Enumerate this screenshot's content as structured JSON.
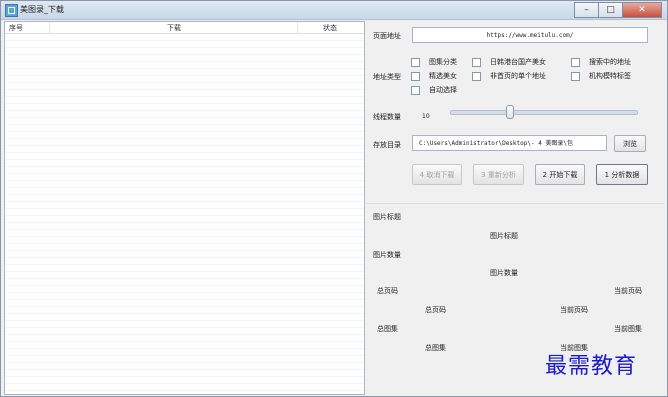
{
  "window": {
    "title": "美图录_下载",
    "minimize": "–",
    "maximize": "□",
    "close": "✕"
  },
  "list": {
    "columns": [
      "序号",
      "下载",
      "状态"
    ]
  },
  "form": {
    "page_url_label": "页面地址",
    "page_url_value": "https://www.meitulu.com/",
    "addr_type_label": "地址类型",
    "checkboxes": [
      "图集分类",
      "日韩港台国产美女",
      "搜索中的地址",
      "精选美女",
      "非首页的单个地址",
      "机构模特标签",
      "自动选择"
    ],
    "threads_label": "线程数量",
    "threads_value": "10",
    "save_dir_label": "存放目录",
    "save_dir_value": "C:\\Users\\Administrator\\Desktop\\-  4 美图录\\包",
    "browse_label": "浏览"
  },
  "actions": {
    "cancel": "4 取消下载",
    "reanalyze": "3 重新分析",
    "start": "2 开始下载",
    "analyze": "1 分析数据"
  },
  "info": {
    "img_title_label": "图片标题",
    "img_title_value": "图片标题",
    "img_count_label": "图片数量",
    "img_count_value": "图片数量",
    "total_pages_label": "总页码",
    "total_pages_value": "总页码",
    "current_page_label": "当前页码",
    "current_page_value": "当前页码",
    "total_sets_label": "总图集",
    "total_sets_value": "总图集",
    "current_set_label": "当前图集",
    "current_set_value": "当前图集"
  },
  "watermark": "最需教育"
}
